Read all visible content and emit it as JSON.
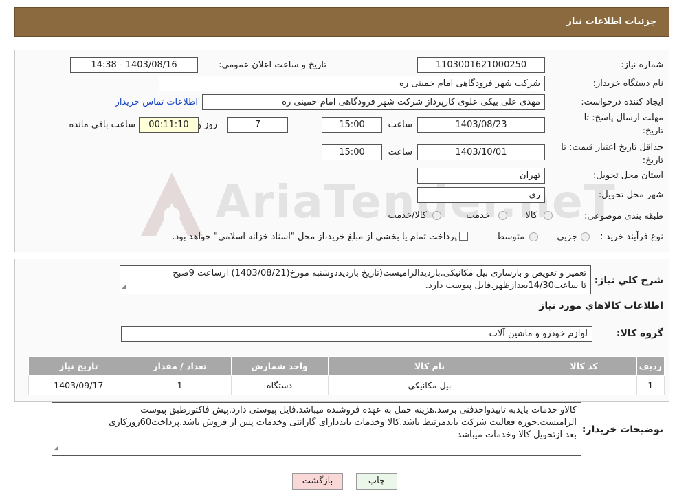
{
  "header": {
    "title": "جزئیات اطلاعات نیاز"
  },
  "watermark": {
    "text": "AriaTender.neT"
  },
  "form": {
    "need_number_label": "شماره نیاز:",
    "need_number": "1103001621000250",
    "announce_label": "تاریخ و ساعت اعلان عمومی:",
    "announce_value": "1403/08/16 - 14:38",
    "buyer_org_label": "نام دستگاه خریدار:",
    "buyer_org": "شرکت شهر فرودگاهی امام خمینی  ره",
    "requester_label": "ایجاد کننده درخواست:",
    "requester": "مهدی علی بیکی علوی کارپرداز شرکت شهر فرودگاهی امام خمینی  ره",
    "contact_link": "اطلاعات تماس خریدار",
    "deadline_label_line1": "مهلت ارسال پاسخ: تا",
    "deadline_label_line2": "تاریخ:",
    "deadline_date": "1403/08/23",
    "time_label": "ساعت",
    "deadline_time": "15:00",
    "days_value": "7",
    "days_label": "روز و",
    "remaining_value": "00:11:10",
    "remaining_label": "ساعت باقی مانده",
    "validity_label_line1": "حداقل تاریخ اعتبار قیمت: تا",
    "validity_label_line2": "تاریخ:",
    "validity_date": "1403/10/01",
    "validity_time": "15:00",
    "province_label": "استان محل تحویل:",
    "province": "تهران",
    "city_label": "شهر محل تحویل:",
    "city": "ری",
    "category_label": "طبقه بندی موضوعی:",
    "category_options": [
      "کالا",
      "خدمت",
      "کالا/خدمت"
    ],
    "process_label": "نوع فرآیند خرید :",
    "process_options": [
      "جزیی",
      "متوسط"
    ],
    "process_note": "پرداخت تمام یا بخشی از مبلغ خرید،از محل \"اسناد خزانه اسلامی\" خواهد بود."
  },
  "description": {
    "label": "شرح کلي نياز:",
    "text_line1": "تعمیر و تعویض و بازسازی بیل مکانیکی.بازدیدالزامیست(تاریخ بازدیددوشنبه مورخ(1403/08/21) ازساعت 9صبح",
    "text_line2": "تا ساعت14/30بعدازظهر.فایل پیوست دارد."
  },
  "goods": {
    "section_title": "اطلاعات کالاهاي مورد نياز",
    "group_label": "گروه کالا:",
    "group_value": "لوازم خودرو و ماشین آلات",
    "columns": [
      "رديف",
      "کد کالا",
      "نام کالا",
      "واحد شمارش",
      "تعداد / مقدار",
      "تاريخ نياز"
    ],
    "rows": [
      [
        "1",
        "--",
        "بیل مکانیکی",
        "دستگاه",
        "1",
        "1403/09/17"
      ]
    ]
  },
  "buyer_notes": {
    "label": "توضيحات خريدار:",
    "line1": "کالاو خدمات بایدبه تاییدواحدفنی برسد.هزینه حمل به عهده فروشنده میباشد.فایل پیوستی دارد.پیش فاکتورطبق پیوست",
    "line2": "الزامیست.حوزه فعالیت شرکت بایدمرتبط باشد.کالا وخدمات بایددارای گارانتی وخدمات پس از فروش باشد.پرداخت60روزکاری",
    "line3": "بعد ازتحویل کالا وخدمات میباشد"
  },
  "buttons": {
    "print": "چاپ",
    "back": "بازگشت"
  }
}
